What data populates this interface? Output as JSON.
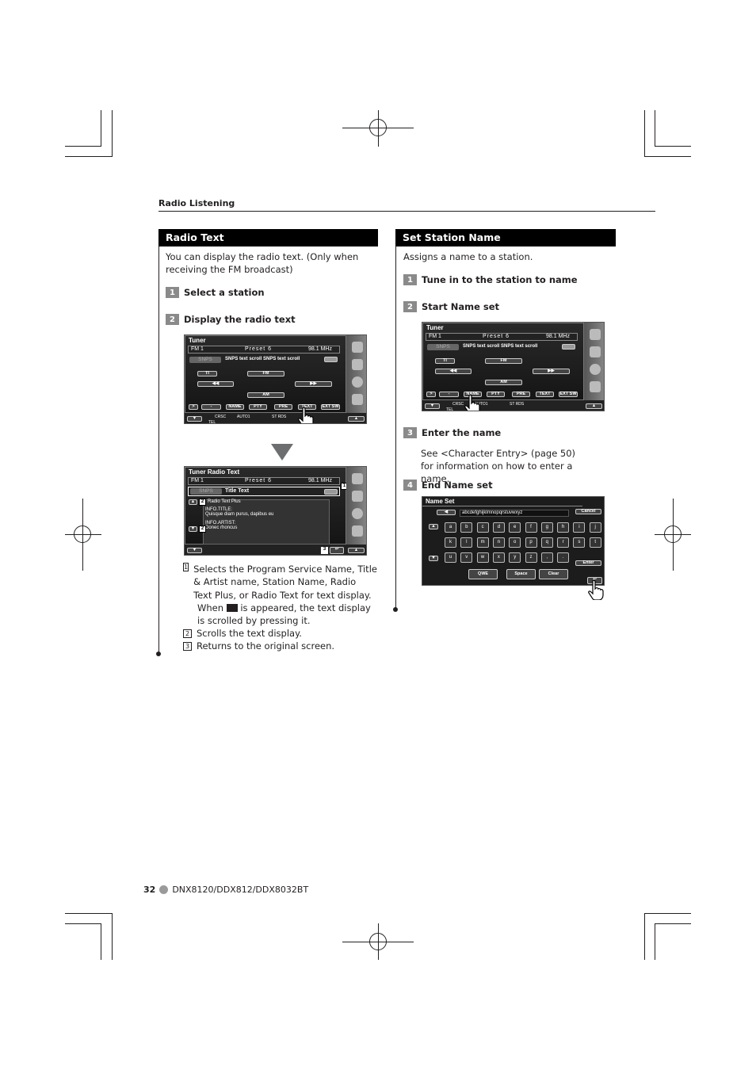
{
  "header": {
    "section": "Radio Listening"
  },
  "radio_text": {
    "title": "Radio Text",
    "intro": "You can display the radio text. (Only when receiving the FM broadcast)",
    "steps": [
      {
        "num": "1",
        "label": "Select a station"
      },
      {
        "num": "2",
        "label": "Display the radio text"
      }
    ],
    "screen1": {
      "title": "Tuner",
      "band": "FM 1",
      "preset": "Preset 6",
      "freq": "98.1  MHz",
      "ps": "SNPS",
      "scroll_text": "SNPS text scroll SNPS text scroll",
      "ti": "TI",
      "fm": "FM",
      "am": "AM",
      "prev": "◀◀",
      "next": "▶▶",
      "buttons": [
        ">",
        "-",
        "NAME",
        "PTY",
        "PRE",
        "TEXT",
        "EXT SW"
      ],
      "status": [
        "CRSC",
        "AUTO1",
        "ST  RDS",
        "TEL"
      ]
    },
    "screen2": {
      "title": "Tuner Radio Text",
      "band": "FM 1",
      "preset": "Preset 6",
      "freq": "98.1  MHz",
      "ps": "SNPS",
      "title_text": "Title Text",
      "lines": [
        "Radio Text Plus",
        "INFO.TITLE:",
        "Quisque diam purus, dapibus eu",
        "INFO.ARTIST:",
        "Donec rhoncus"
      ],
      "callouts": [
        "1",
        "2",
        "2",
        "3"
      ]
    },
    "notes": [
      {
        "num": "1",
        "text": "Selects the Program Service Name, Title & Artist name, Station Name, Radio Text Plus, or Radio Text for text display.",
        "text2a": "When ",
        "text2b": " is appeared, the text display is scrolled by pressing it."
      },
      {
        "num": "2",
        "text": "Scrolls the text display."
      },
      {
        "num": "3",
        "text": "Returns to the original screen."
      }
    ]
  },
  "station_name": {
    "title": "Set Station Name",
    "intro": "Assigns a name to a station.",
    "steps": [
      {
        "num": "1",
        "label": "Tune in to the station to name"
      },
      {
        "num": "2",
        "label": "Start Name set"
      },
      {
        "num": "3",
        "label": "Enter the name"
      },
      {
        "num": "4",
        "label": "End Name set"
      }
    ],
    "step3_text": "See <Character Entry> (page 50) for information on how to enter a name.",
    "nameset": {
      "title": "Name Set",
      "input": "abcdefghijklmnopqrstuvwxyz",
      "back": "◀",
      "cancel": "Cancel",
      "enter": "Enter",
      "qwe": "QWE",
      "space": "Space",
      "clear": "Clear",
      "keys": [
        "a",
        "b",
        "c",
        "d",
        "e",
        "f",
        "g",
        "h",
        "i",
        "j",
        "k",
        "l",
        "m",
        "n",
        "o",
        "p",
        "q",
        "r",
        "s",
        "t",
        "u",
        "v",
        "w",
        "x",
        "y",
        "z",
        ",",
        "."
      ]
    }
  },
  "footer": {
    "page": "32",
    "model": "DNX8120/DDX812/DDX8032BT"
  }
}
